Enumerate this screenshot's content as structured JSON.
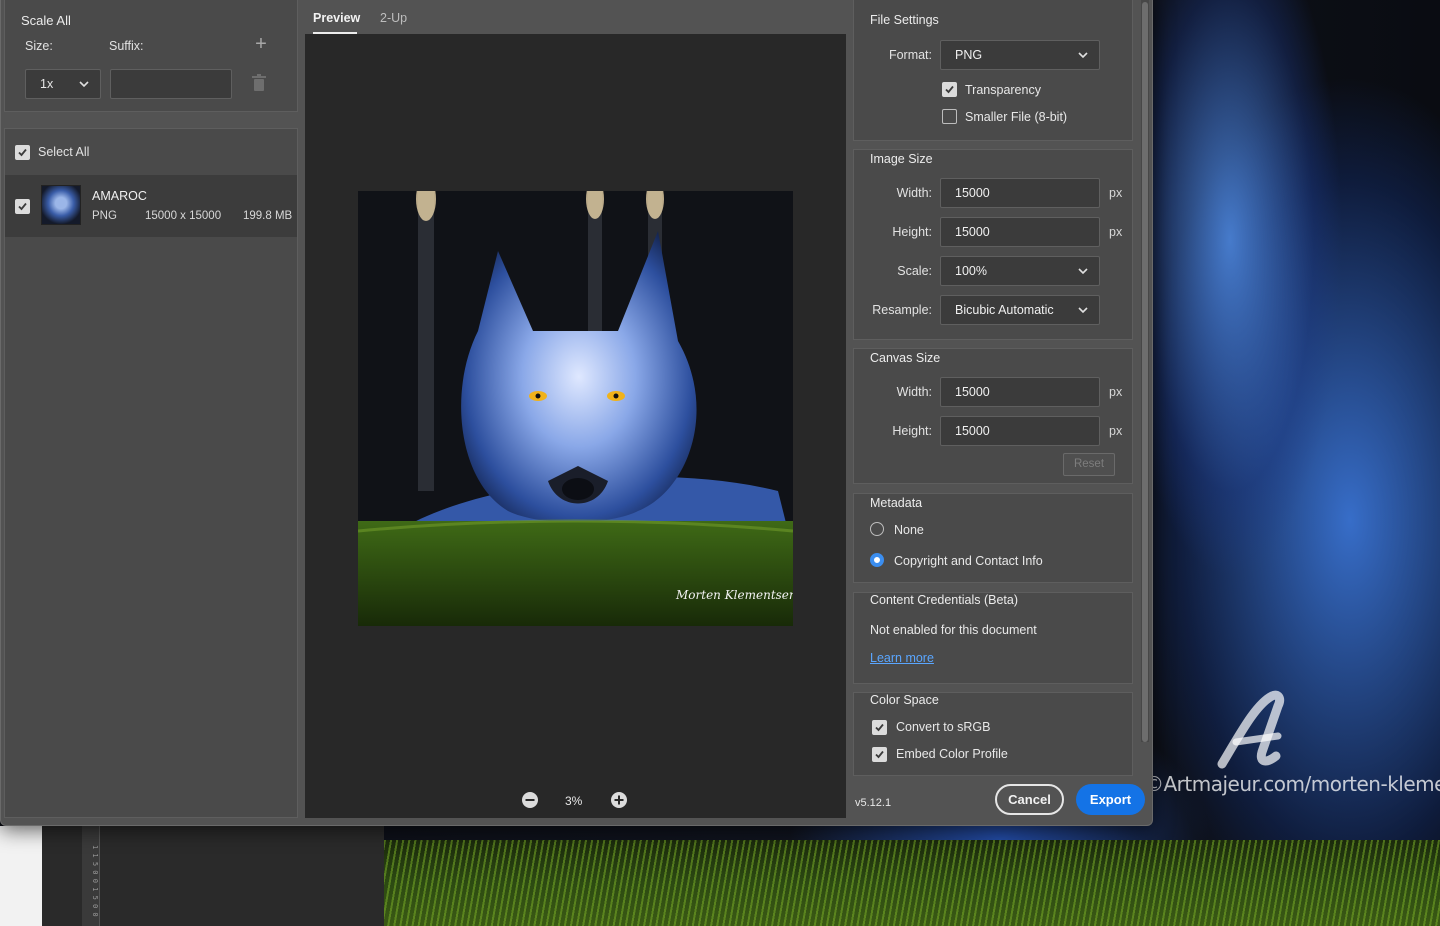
{
  "left": {
    "scale_all_label": "Scale All",
    "size_label": "Size:",
    "suffix_label": "Suffix:",
    "size_value": "1x",
    "suffix_value": "",
    "select_all_label": "Select All",
    "asset": {
      "name": "AMAROC",
      "format": "PNG",
      "dimensions": "15000 x 15000",
      "file_size": "199.8 MB"
    }
  },
  "tabs": [
    {
      "label": "Preview",
      "active": true
    },
    {
      "label": "2-Up",
      "active": false
    }
  ],
  "preview": {
    "zoom": "3%",
    "signature": "Morten Klementsen"
  },
  "file_settings": {
    "title": "File Settings",
    "format_label": "Format:",
    "format_value": "PNG",
    "transparency_label": "Transparency",
    "transparency_checked": true,
    "smaller_file_label": "Smaller File (8-bit)",
    "smaller_file_checked": false
  },
  "image_size": {
    "title": "Image Size",
    "width_label": "Width:",
    "width_value": "15000",
    "height_label": "Height:",
    "height_value": "15000",
    "unit": "px",
    "scale_label": "Scale:",
    "scale_value": "100%",
    "resample_label": "Resample:",
    "resample_value": "Bicubic Automatic"
  },
  "canvas_size": {
    "title": "Canvas Size",
    "width_label": "Width:",
    "width_value": "15000",
    "height_label": "Height:",
    "height_value": "15000",
    "unit": "px",
    "reset_label": "Reset"
  },
  "metadata": {
    "title": "Metadata",
    "options": [
      {
        "label": "None",
        "selected": false
      },
      {
        "label": "Copyright and Contact Info",
        "selected": true
      }
    ]
  },
  "content_credentials": {
    "title": "Content Credentials (Beta)",
    "status": "Not enabled for this document",
    "learn_more": "Learn more"
  },
  "color_space": {
    "title": "Color Space",
    "convert_label": "Convert to sRGB",
    "convert_checked": true,
    "embed_label": "Embed Color Profile",
    "embed_checked": true
  },
  "footer": {
    "version": "v5.12.1",
    "cancel_label": "Cancel",
    "export_label": "Export"
  },
  "background": {
    "watermark": "©Artmajeur.com/morten-klementsen",
    "ruler_text": "1 1 5 0 0 1 5 0 0"
  },
  "colors": {
    "accent": "#1473e6",
    "radio_selected": "#3b8ef0",
    "link": "#5aa6ff",
    "dialog_bg": "#535353"
  }
}
